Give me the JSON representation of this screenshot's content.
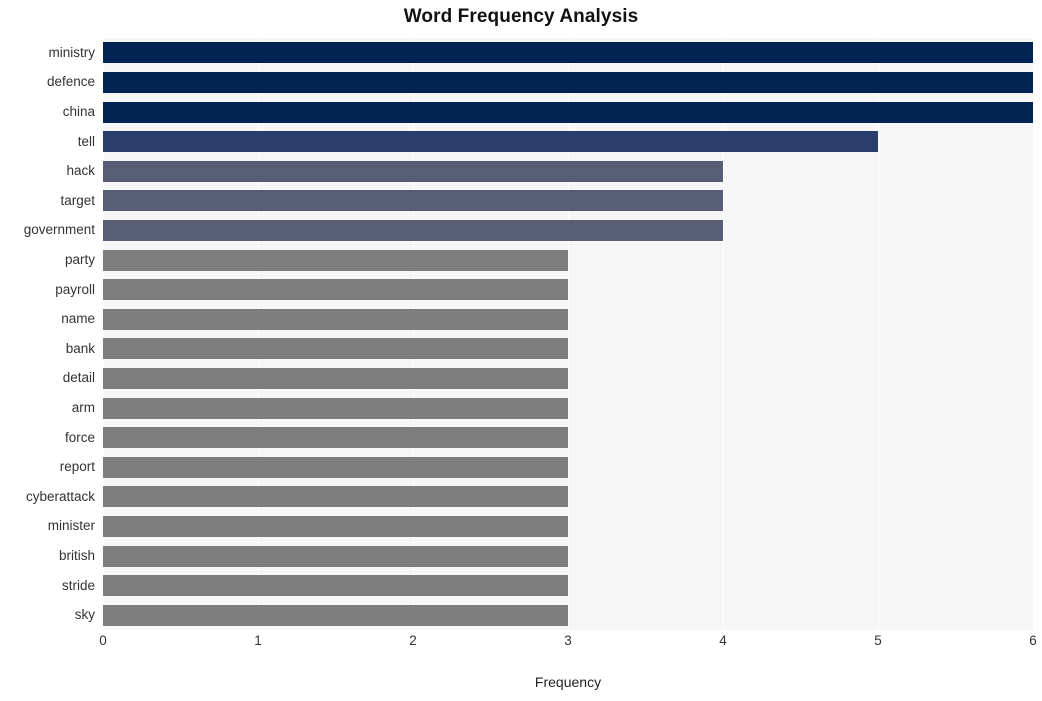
{
  "chart_data": {
    "type": "bar",
    "orientation": "horizontal",
    "title": "Word Frequency Analysis",
    "xlabel": "Frequency",
    "ylabel": "",
    "xlim": [
      0,
      6
    ],
    "xticks": [
      "0",
      "1",
      "2",
      "3",
      "4",
      "5",
      "6"
    ],
    "grid": true,
    "legend": "none",
    "categories": [
      "ministry",
      "defence",
      "china",
      "tell",
      "hack",
      "target",
      "government",
      "party",
      "payroll",
      "name",
      "bank",
      "detail",
      "arm",
      "force",
      "report",
      "cyberattack",
      "minister",
      "british",
      "stride",
      "sky"
    ],
    "values": [
      6,
      6,
      6,
      5,
      4,
      4,
      4,
      3,
      3,
      3,
      3,
      3,
      3,
      3,
      3,
      3,
      3,
      3,
      3,
      3
    ],
    "bar_colors": [
      "#022452",
      "#022452",
      "#022452",
      "#2a3e6e",
      "#565d75",
      "#565d75",
      "#565d75",
      "#7d7d7d",
      "#7d7d7d",
      "#7d7d7d",
      "#7d7d7d",
      "#7d7d7d",
      "#7d7d7d",
      "#7d7d7d",
      "#7d7d7d",
      "#7d7d7d",
      "#7d7d7d",
      "#7d7d7d",
      "#7d7d7d",
      "#7d7d7d"
    ]
  },
  "style": {
    "plot_background": "#f6f6f6",
    "figure_background": "#ffffff",
    "gridline_color": "#ffffff",
    "tick_label_color": "#333333",
    "title_color": "#111111"
  }
}
